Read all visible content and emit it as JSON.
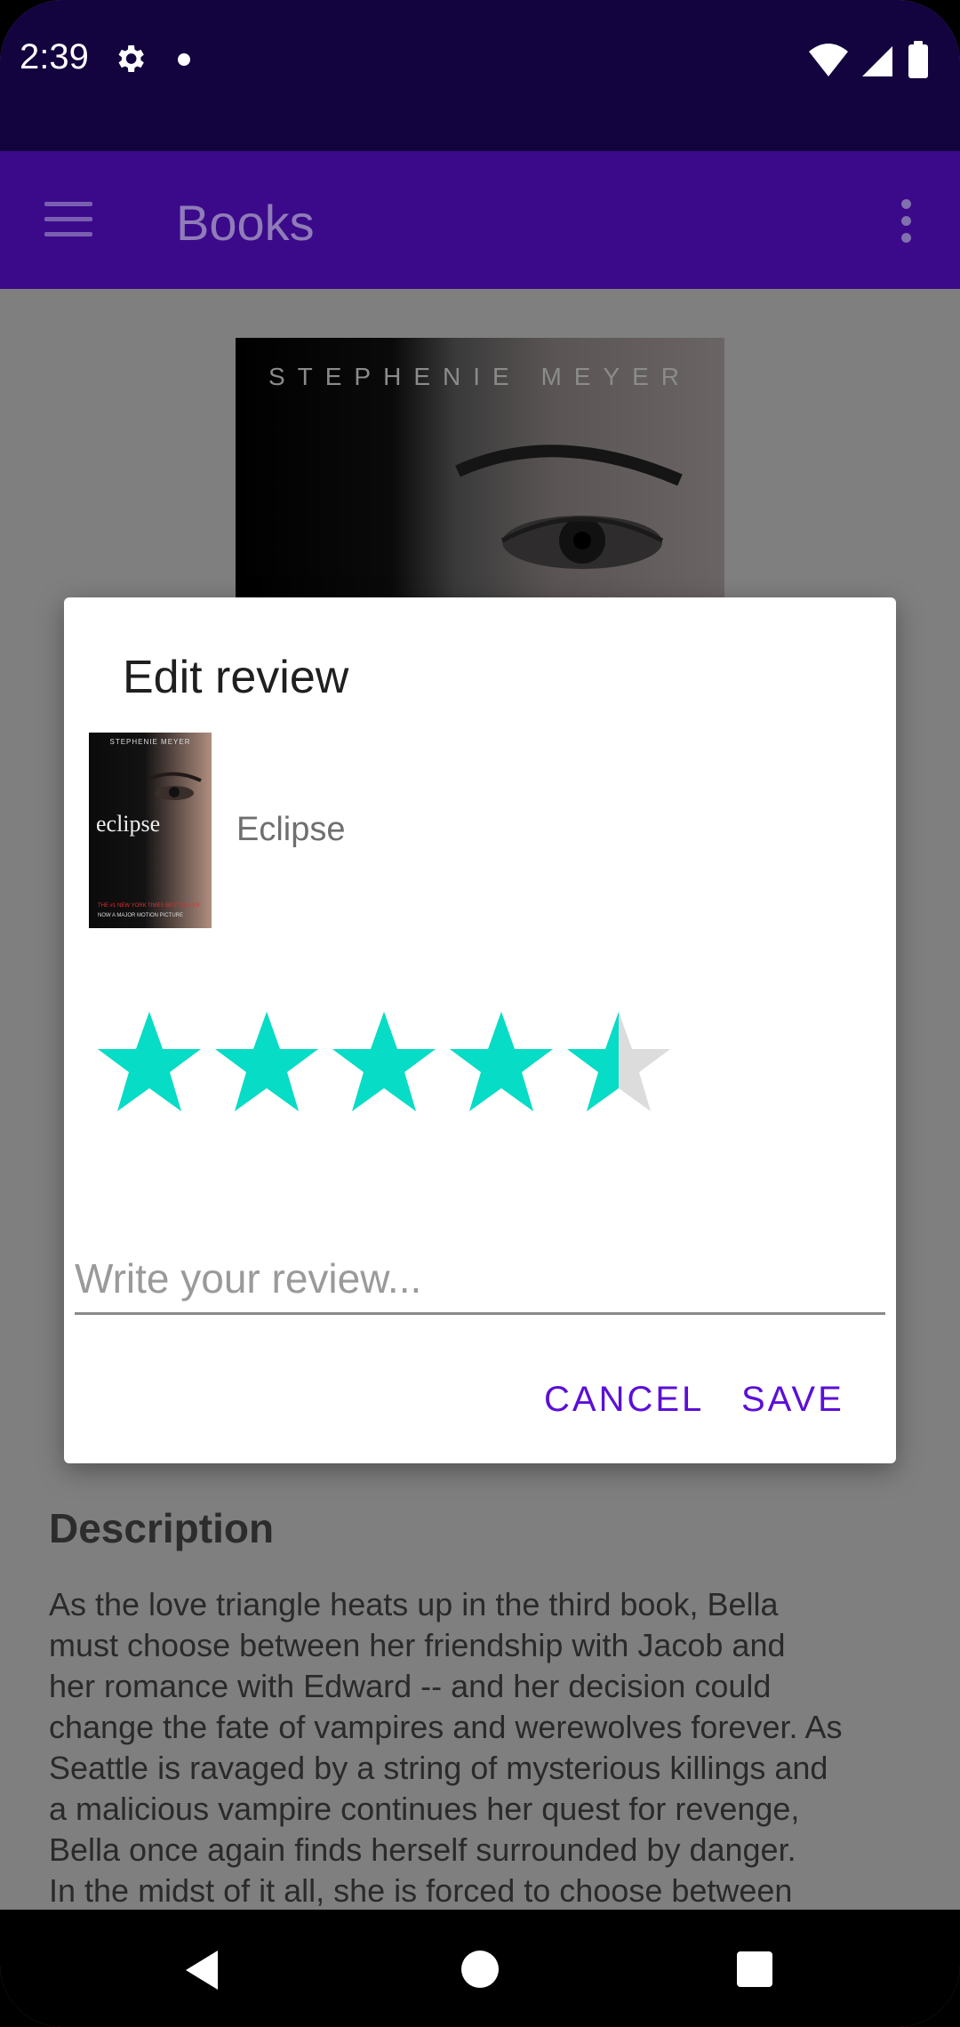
{
  "status_bar": {
    "time": "2:39",
    "icons": [
      "settings-gear-icon",
      "notification-dot-icon",
      "wifi-icon",
      "signal-icon",
      "battery-icon"
    ]
  },
  "app_bar": {
    "title": "Books",
    "icons": [
      "menu-icon",
      "overflow-menu-icon"
    ]
  },
  "background": {
    "cover_author": "STEPHENIE MEYER",
    "description_heading": "Description",
    "description_lines": [
      "As the love triangle heats up in the third book, Bella",
      "must choose between her friendship with Jacob and",
      "her romance with Edward -- and her decision could",
      "change the fate of vampires and werewolves forever. As",
      "Seattle is ravaged by a string of mysterious killings and",
      "a malicious vampire continues her quest for revenge,",
      "Bella once again finds herself surrounded by danger.",
      "In the midst of it all, she is forced to choose between"
    ]
  },
  "dialog": {
    "title": "Edit review",
    "book_title": "Eclipse",
    "thumbnail": {
      "author": "STEPHENIE MEYER",
      "title": "eclipse",
      "footer1": "THE #1 NEW YORK TIMES BESTSELLER",
      "footer2": "NOW A MAJOR MOTION PICTURE"
    },
    "rating": {
      "value": 4.5,
      "max": 5
    },
    "review_placeholder": "Write your review...",
    "review_value": "",
    "cancel_label": "CANCEL",
    "save_label": "SAVE"
  },
  "colors": {
    "status_bar": "#13033f",
    "app_bar": "#3b0a8a",
    "star_filled": "#06dcc6",
    "star_empty": "#dcdcdc",
    "accent": "#5b0fd6"
  },
  "nav_bar": {
    "icons": [
      "back-icon",
      "home-icon",
      "recents-icon"
    ]
  }
}
